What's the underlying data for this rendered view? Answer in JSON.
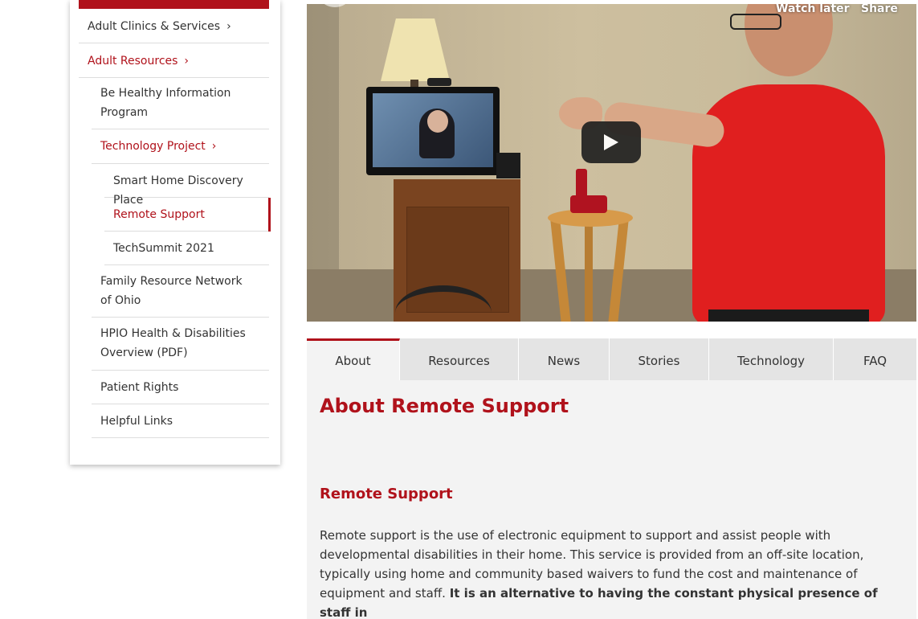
{
  "sidebar": {
    "items": [
      {
        "label": "Adult Clinics & Services",
        "chevron": "›"
      },
      {
        "label": "Adult Resources",
        "chevron": "›"
      },
      {
        "label": "Be Healthy Information Program"
      },
      {
        "label": "Technology Project",
        "chevron": "›"
      },
      {
        "label": "Smart Home Discovery Place"
      },
      {
        "label": "Remote Support"
      },
      {
        "label": "TechSummit 2021"
      },
      {
        "label": "Family Resource Network of Ohio"
      },
      {
        "label": "HPIO Health & Disabilities Overview (PDF)"
      },
      {
        "label": "Patient Rights"
      },
      {
        "label": "Helpful Links"
      }
    ]
  },
  "video": {
    "watch_later": "Watch later",
    "share": "Share",
    "play_icon": "play-icon"
  },
  "tabs": [
    {
      "label": "About"
    },
    {
      "label": "Resources"
    },
    {
      "label": "News"
    },
    {
      "label": "Stories"
    },
    {
      "label": "Technology"
    },
    {
      "label": "FAQ"
    }
  ],
  "content": {
    "title": "About Remote Support",
    "subtitle": "Remote Support",
    "body_normal": "Remote support is the use of electronic equipment to support and assist people with developmental disabilities in their home. This service is provided from an off-site location, typically using home and community based waivers to fund the cost and maintenance of equipment and staff. ",
    "body_strong": "It is an alternative to having the constant physical presence of staff in"
  },
  "colors": {
    "brand_red": "#b0121b",
    "tab_bg": "#e4e4e4",
    "panel_bg": "#f3f3f3"
  }
}
